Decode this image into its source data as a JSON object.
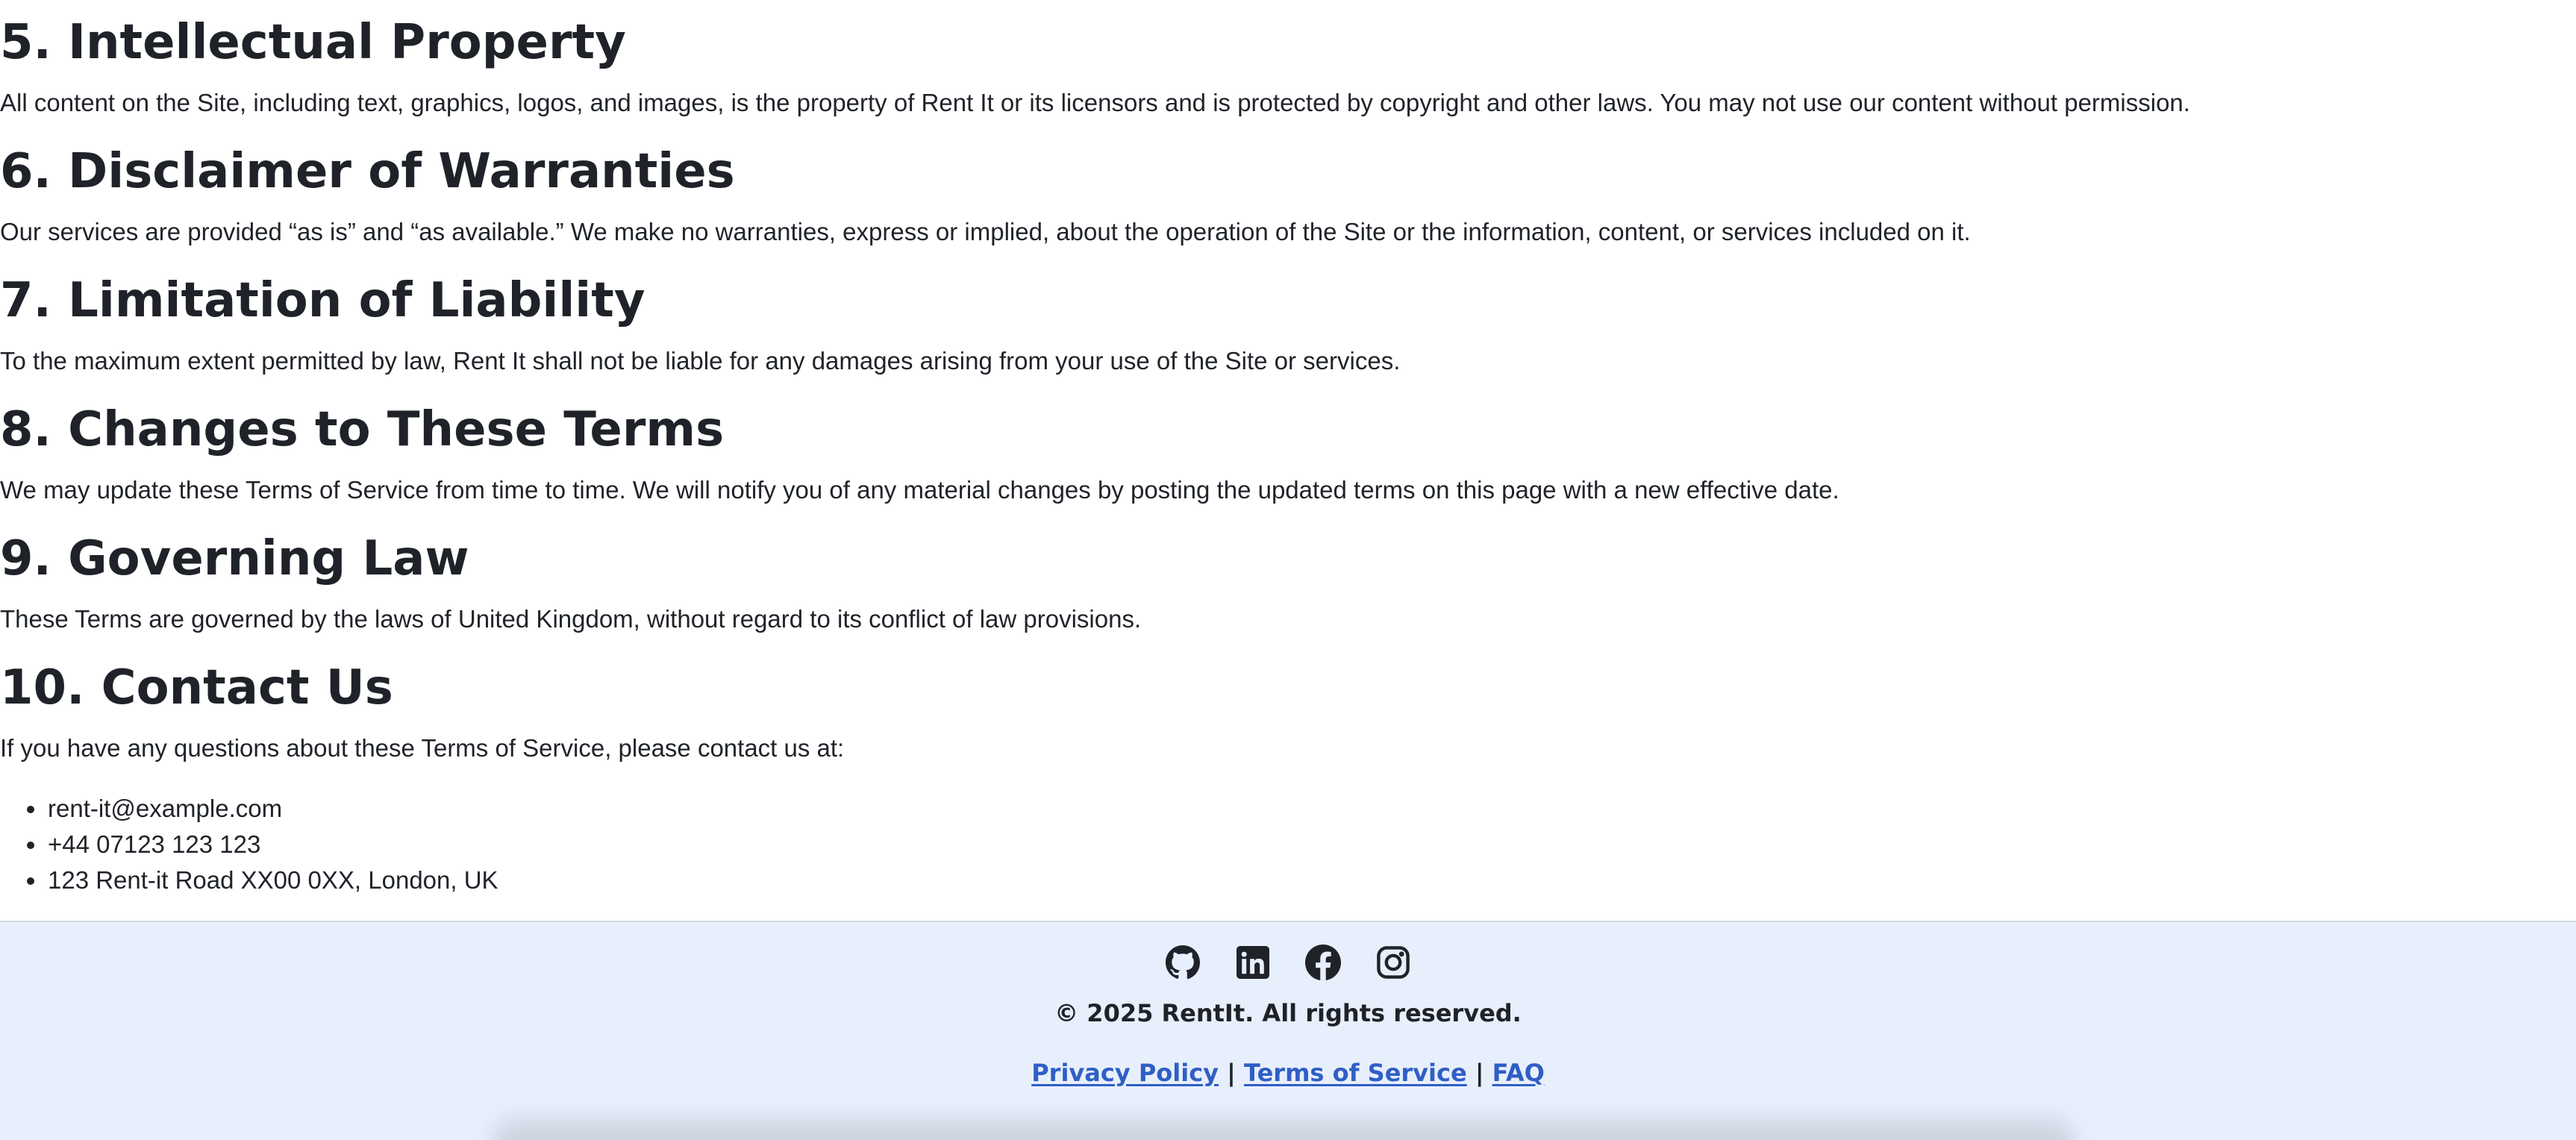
{
  "sections": [
    {
      "heading": "5. Intellectual Property",
      "body": "All content on the Site, including text, graphics, logos, and images, is the property of Rent It or its licensors and is protected by copyright and other laws. You may not use our content without permission."
    },
    {
      "heading": "6. Disclaimer of Warranties",
      "body": "Our services are provided “as is” and “as available.” We make no warranties, express or implied, about the operation of the Site or the information, content, or services included on it."
    },
    {
      "heading": "7. Limitation of Liability",
      "body": "To the maximum extent permitted by law, Rent It shall not be liable for any damages arising from your use of the Site or services."
    },
    {
      "heading": "8. Changes to These Terms",
      "body": "We may update these Terms of Service from time to time. We will notify you of any material changes by posting the updated terms on this page with a new effective date."
    },
    {
      "heading": "9. Governing Law",
      "body": "These Terms are governed by the laws of United Kingdom, without regard to its conflict of law provisions."
    },
    {
      "heading": "10. Contact Us",
      "body": "If you have any questions about these Terms of Service, please contact us at:"
    }
  ],
  "contact": {
    "items": [
      "rent-it@example.com",
      "+44 07123 123 123",
      "123 Rent-it Road XX00 0XX, London, UK"
    ]
  },
  "footer": {
    "social_icons": [
      "github-icon",
      "linkedin-icon",
      "facebook-icon",
      "instagram-icon"
    ],
    "copyright": "© 2025 RentIt. All rights reserved.",
    "links": {
      "privacy": "Privacy Policy",
      "terms": "Terms of Service",
      "faq": "FAQ",
      "separator": "|"
    },
    "colors": {
      "background": "#e8effc",
      "link": "#2f5fc6",
      "text": "#1f2329"
    }
  }
}
